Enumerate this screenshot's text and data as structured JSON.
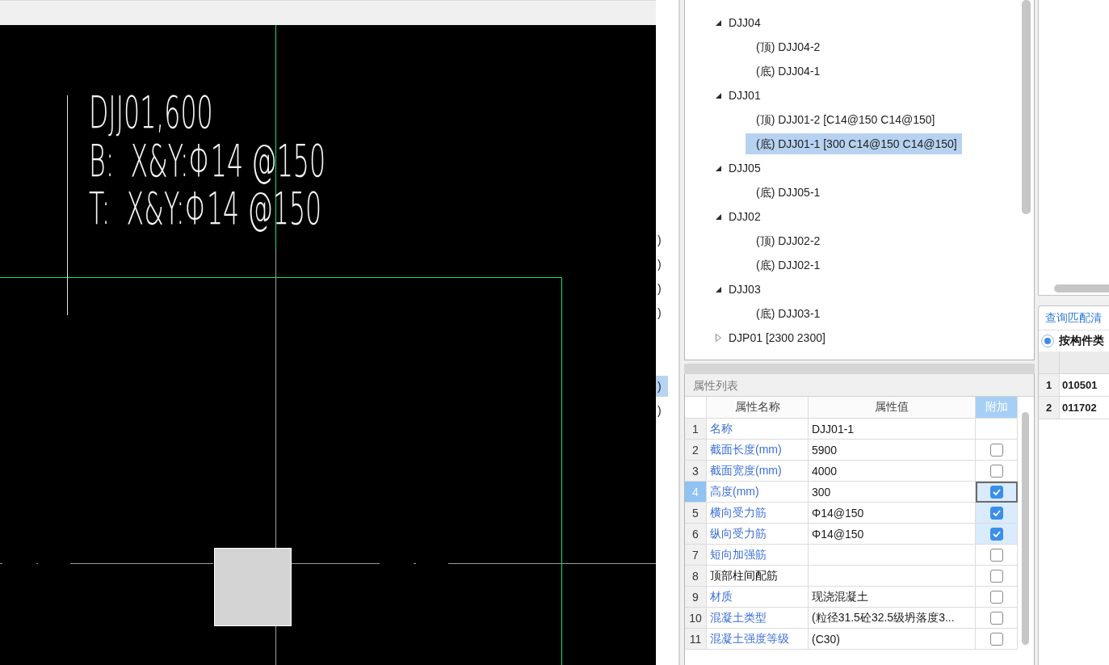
{
  "cad_canvas": {
    "annotation_lines": [
      "DJJ01,600",
      "B:  X&Y:Φ14 @150",
      "T:  X&Y:Φ14 @150"
    ]
  },
  "side_list": {
    "groups": [
      {
        "items": [
          {
            "label": ")",
            "selected": false
          },
          {
            "label": ")",
            "selected": false
          },
          {
            "label": ")",
            "selected": false
          },
          {
            "label": ")",
            "selected": false
          }
        ]
      },
      {
        "items": [
          {
            "label": ")",
            "selected": true
          },
          {
            "label": ")",
            "selected": false
          }
        ]
      }
    ]
  },
  "component_tree": {
    "items": [
      {
        "label": "DJJ04",
        "expanded": true,
        "selected": false,
        "children": [
          {
            "label": "(顶) DJJ04-2",
            "selected": false
          },
          {
            "label": "(底) DJJ04-1",
            "selected": false
          }
        ]
      },
      {
        "label": "DJJ01",
        "expanded": true,
        "selected": false,
        "children": [
          {
            "label": "(顶) DJJ01-2 [C14@150 C14@150]",
            "selected": false
          },
          {
            "label": "(底) DJJ01-1 [300 C14@150 C14@150]",
            "selected": true
          }
        ]
      },
      {
        "label": "DJJ05",
        "expanded": true,
        "selected": false,
        "children": [
          {
            "label": "(底) DJJ05-1",
            "selected": false
          }
        ]
      },
      {
        "label": "DJJ02",
        "expanded": true,
        "selected": false,
        "children": [
          {
            "label": "(顶) DJJ02-2",
            "selected": false
          },
          {
            "label": "(底) DJJ02-1",
            "selected": false
          }
        ]
      },
      {
        "label": "DJJ03",
        "expanded": true,
        "selected": false,
        "children": [
          {
            "label": "(底) DJJ03-1",
            "selected": false
          }
        ]
      },
      {
        "label": "DJP01 [2300 2300]",
        "expanded": false,
        "selected": false
      }
    ]
  },
  "property_panel": {
    "title": "属性列表",
    "columns": [
      {
        "label": "属性名称",
        "selected": false
      },
      {
        "label": "属性值",
        "selected": false
      },
      {
        "label": "附加",
        "selected": true
      }
    ],
    "rows": [
      {
        "number": "1",
        "name": "名称",
        "public": true,
        "value": "DJJ01-1",
        "selected": false
      },
      {
        "number": "2",
        "name": "截面长度(mm)",
        "public": true,
        "value": "5900",
        "checked": false,
        "selected": false
      },
      {
        "number": "3",
        "name": "截面宽度(mm)",
        "public": true,
        "value": "4000",
        "checked": false,
        "selected": false
      },
      {
        "number": "4",
        "name": "高度(mm)",
        "public": true,
        "value": "300",
        "checked": true,
        "selected": true
      },
      {
        "number": "5",
        "name": "横向受力筋",
        "public": true,
        "value": "Φ14@150",
        "checked": true,
        "selected": false
      },
      {
        "number": "6",
        "name": "纵向受力筋",
        "public": true,
        "value": "Φ14@150",
        "checked": true,
        "selected": false
      },
      {
        "number": "7",
        "name": "短向加强筋",
        "public": true,
        "checked": false,
        "selected": false
      },
      {
        "number": "8",
        "name": "顶部柱间配筋",
        "public": false,
        "checked": false,
        "selected": false
      },
      {
        "number": "9",
        "name": "材质",
        "public": true,
        "value": "现浇混凝土",
        "checked": false,
        "selected": false
      },
      {
        "number": "10",
        "name": "混凝土类型",
        "public": true,
        "value": "(粒径31.5砼32.5级坍落度3...",
        "checked": false,
        "selected": false
      },
      {
        "number": "11",
        "name": "混凝土强度等级",
        "public": true,
        "value": "(C30)",
        "checked": false,
        "selected": false
      }
    ]
  },
  "match_panel": {
    "title": "查询匹配清",
    "radio": {
      "label": "按构件类",
      "selected": true
    },
    "rows": [
      {
        "number": "1",
        "code": "010501"
      },
      {
        "number": "2",
        "code": "011702"
      }
    ]
  }
}
